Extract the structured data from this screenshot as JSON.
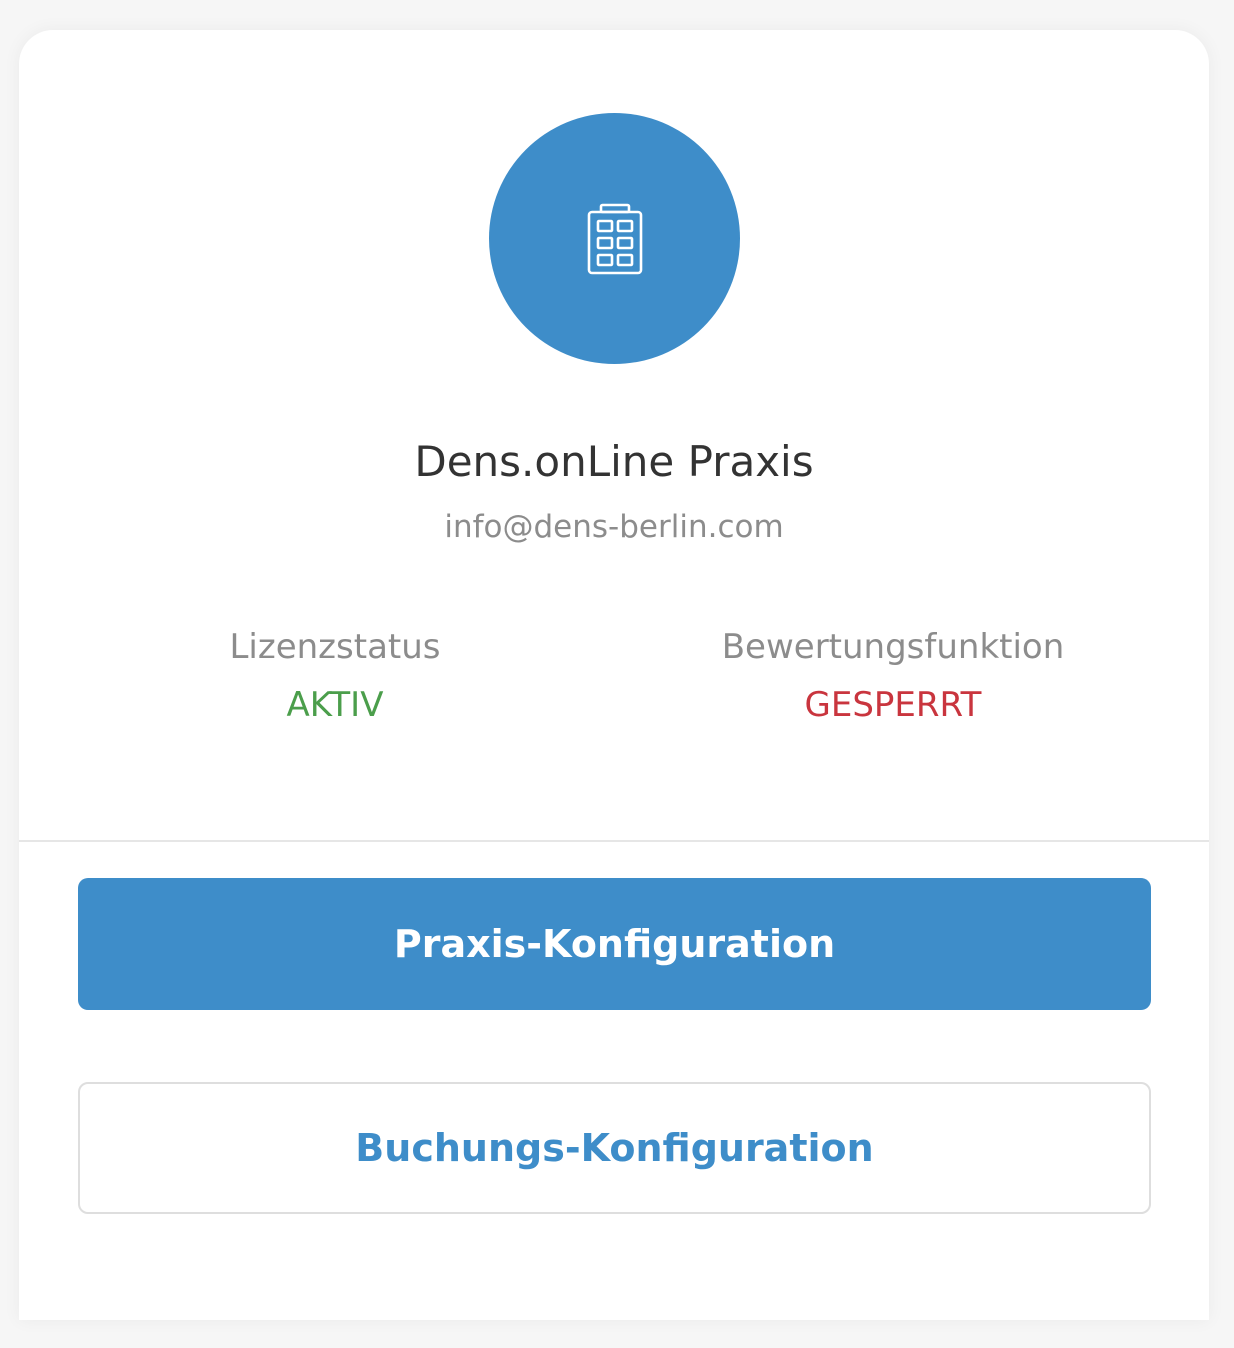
{
  "profile": {
    "name": "Dens.onLine Praxis",
    "email": "info@dens-berlin.com",
    "icon": "building-icon"
  },
  "stats": {
    "license": {
      "label": "Lizenzstatus",
      "value": "AKTIV"
    },
    "rating": {
      "label": "Bewertungsfunktion",
      "value": "GESPERRT"
    }
  },
  "actions": {
    "primary_label": "Praxis-Konfiguration",
    "secondary_label": "Buchungs-Konfiguration"
  },
  "colors": {
    "accent": "#3e8dc9",
    "success": "#4b9e4b",
    "danger": "#c9353e"
  }
}
